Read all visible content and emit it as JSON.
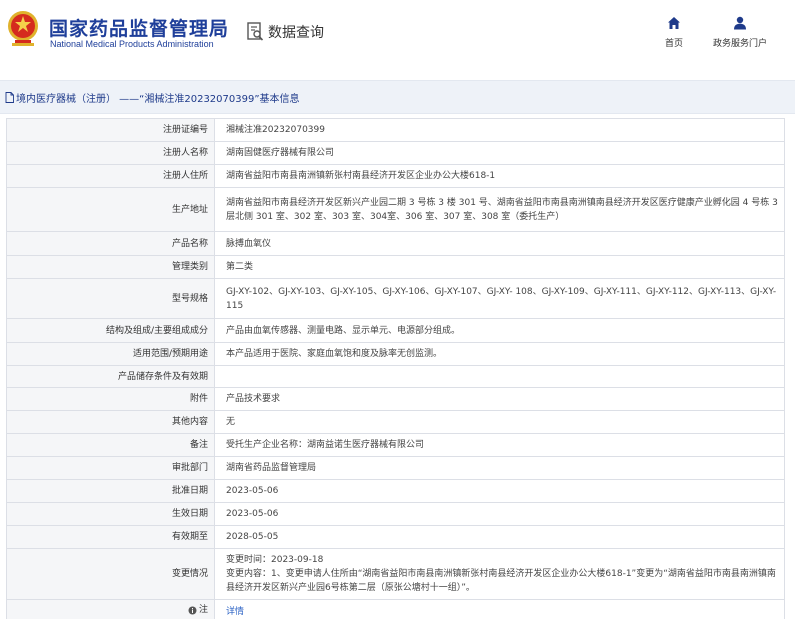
{
  "header": {
    "brand_cn": "国家药品监督管理局",
    "brand_en": "National Medical Products Administration",
    "query_title": "数据查询",
    "nav": [
      {
        "label": "首页",
        "icon": "home-icon"
      },
      {
        "label": "政务服务门户",
        "icon": "user-icon"
      }
    ]
  },
  "breadcrumb": {
    "icon": "document-icon",
    "text": "境内医疗器械（注册） ——“湘械注准20232070399”基本信息"
  },
  "colors": {
    "brand_blue": "#1f3f9a",
    "link_blue": "#2b62c4",
    "label_bg": "#f5f6f8",
    "bar_bg": "#eef2f8"
  },
  "rows": [
    {
      "label": "注册证编号",
      "value": "湘械注准20232070399"
    },
    {
      "label": "注册人名称",
      "value": "湖南固健医疗器械有限公司"
    },
    {
      "label": "注册人住所",
      "value": "湖南省益阳市南县南洲镇新张村南县经济开发区企业办公大楼618-1"
    },
    {
      "label": "生产地址",
      "value": "湖南省益阳市南县经济开发区新兴产业园二期 3 号栋 3 楼 301 号、湖南省益阳市南县南洲镇南县经济开发区医疗健康产业孵化园 4 号栋 3 层北侧 301 室、302 室、303 室、304室、306 室、307 室、308 室（委托生产）"
    },
    {
      "label": "产品名称",
      "value": "脉搏血氧仪"
    },
    {
      "label": "管理类别",
      "value": "第二类"
    },
    {
      "label": "型号规格",
      "value": "GJ-XY-102、GJ-XY-103、GJ-XY-105、GJ-XY-106、GJ-XY-107、GJ-XY- 108、GJ-XY-109、GJ-XY-111、GJ-XY-112、GJ-XY-113、GJ-XY-115"
    },
    {
      "label": "结构及组成/主要组成成分",
      "value": "产品由血氧传感器、测量电路、显示单元、电源部分组成。"
    },
    {
      "label": "适用范围/预期用途",
      "value": "本产品适用于医院、家庭血氧饱和度及脉率无创监测。"
    },
    {
      "label": "产品储存条件及有效期",
      "value": ""
    },
    {
      "label": "附件",
      "value": "产品技术要求"
    },
    {
      "label": "其他内容",
      "value": "无"
    },
    {
      "label": "备注",
      "value": "受托生产企业名称：湖南益诺生医疗器械有限公司"
    },
    {
      "label": "审批部门",
      "value": "湖南省药品监督管理局"
    },
    {
      "label": "批准日期",
      "value": "2023-05-06"
    },
    {
      "label": "生效日期",
      "value": "2023-05-06"
    },
    {
      "label": "有效期至",
      "value": "2028-05-05"
    },
    {
      "label": "变更情况",
      "value_line1": "变更时间：2023-09-18",
      "value_line2": "变更内容：1、变更申请人住所由“湖南省益阳市南县南洲镇新张村南县经济开发区企业办公大楼618-1”变更为“湖南省益阳市南县南洲镇南县经济开发区新兴产业园6号栋第二层（原张公塘村十一组）”。"
    },
    {
      "label": "注",
      "value": "详情",
      "icon": "info-icon"
    }
  ]
}
